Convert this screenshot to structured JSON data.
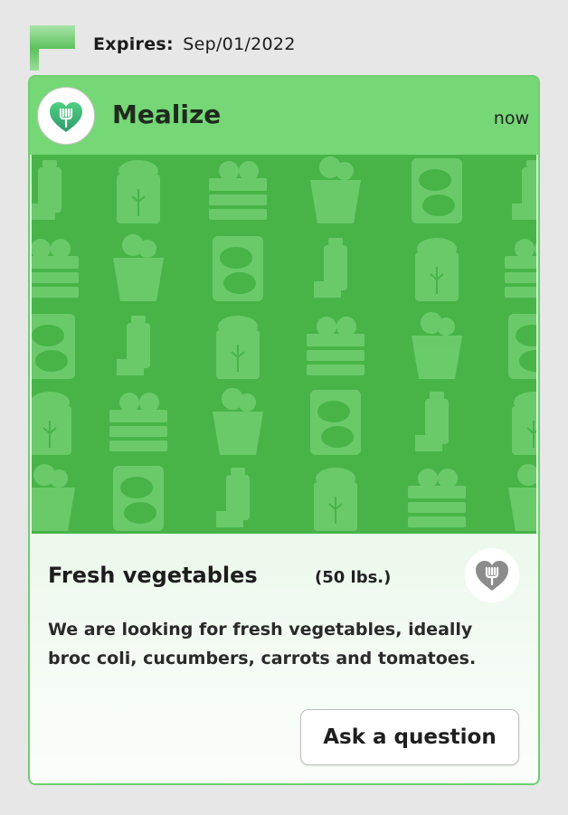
{
  "expires": {
    "label": "Expires:",
    "date": "Sep/01/2022"
  },
  "card": {
    "app_name": "Mealize",
    "time": "now",
    "item_title": "Fresh vegetables",
    "quantity": "(50 lbs.)",
    "description": "We are looking for fresh vegetables, ideally broc coli, cucumbers, carrots and tomatoes.",
    "ask_button": "Ask a question"
  },
  "colors": {
    "header_green": "#76d776",
    "banner_green": "#48b448",
    "icon_green": "#6ccc6c",
    "logo_green": "#3cae6e"
  },
  "icons": [
    "flag-icon",
    "mealize-logo-icon",
    "heart-fork-icon",
    "grocery-pattern-icons"
  ]
}
